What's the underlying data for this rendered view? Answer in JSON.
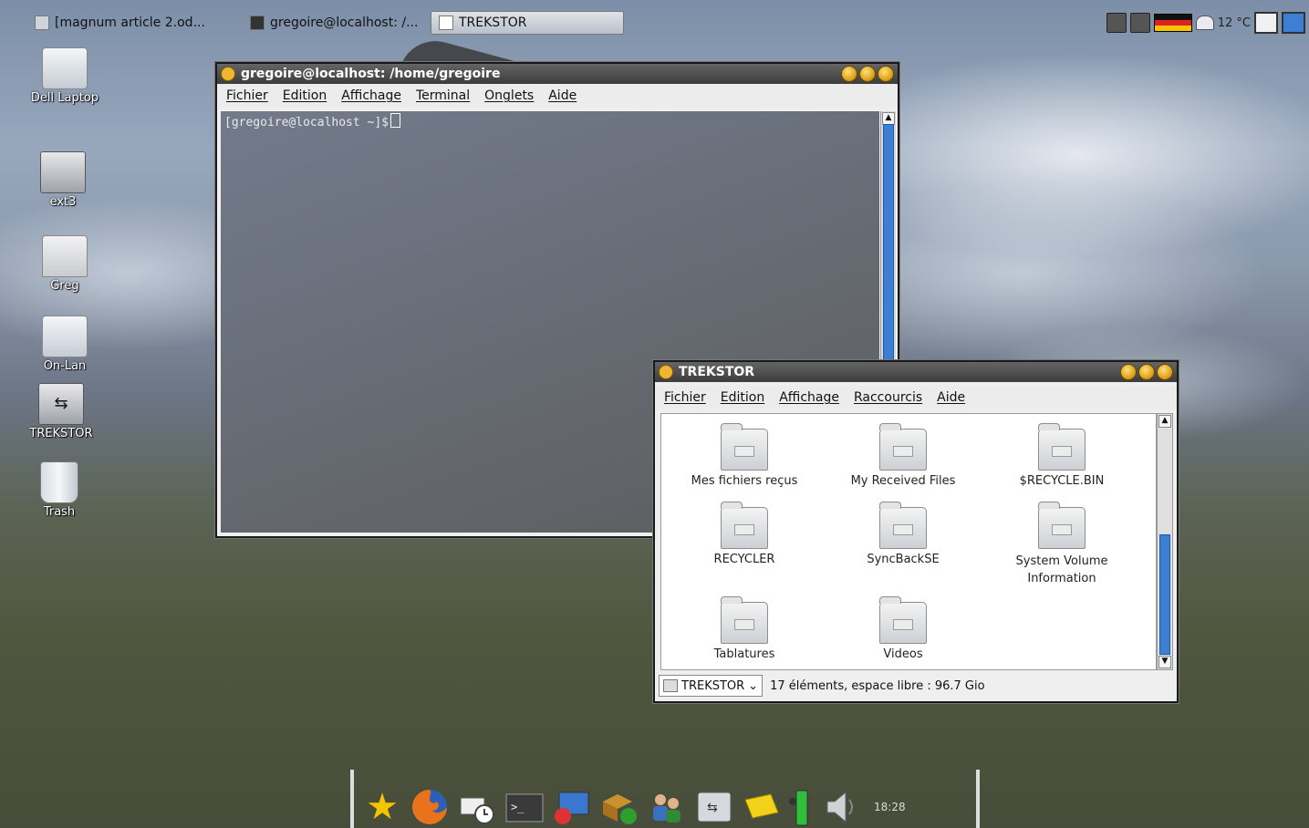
{
  "taskbar": {
    "tasks": [
      {
        "label": "[magnum article 2.od..."
      },
      {
        "label": "gregoire@localhost: /..."
      },
      {
        "label": "TREKSTOR"
      }
    ],
    "temperature": "12 °C"
  },
  "desktop": {
    "icons": [
      {
        "label": "Dell Laptop",
        "icon": "laptop-icon"
      },
      {
        "label": "ext3",
        "icon": "drive-icon"
      },
      {
        "label": "Greg",
        "icon": "home-folder-icon"
      },
      {
        "label": "On-Lan",
        "icon": "network-icon"
      },
      {
        "label": "TREKSTOR",
        "icon": "usb-drive-icon"
      },
      {
        "label": "Trash",
        "icon": "trash-icon"
      }
    ]
  },
  "terminal": {
    "title": "gregoire@localhost: /home/gregoire",
    "menu": [
      "Fichier",
      "Edition",
      "Affichage",
      "Terminal",
      "Onglets",
      "Aide"
    ],
    "prompt": "[gregoire@localhost ~]$"
  },
  "file_manager": {
    "title": "TREKSTOR",
    "menu": [
      "Fichier",
      "Edition",
      "Affichage",
      "Raccourcis",
      "Aide"
    ],
    "items": [
      {
        "label": "Mes fichiers reçus"
      },
      {
        "label": "My Received Files"
      },
      {
        "label": "$RECYCLE.BIN"
      },
      {
        "label": "RECYCLER"
      },
      {
        "label": "SyncBackSE"
      },
      {
        "label": "System Volume Information"
      },
      {
        "label": "Tablatures"
      },
      {
        "label": "Videos"
      }
    ],
    "location": "TREKSTOR",
    "status": "17 éléments, espace libre : 96.7 Gio"
  },
  "dock": {
    "items": [
      "star-icon",
      "firefox-icon",
      "mail-clock-icon",
      "terminal-icon",
      "display-settings-icon",
      "package-manager-icon",
      "users-icon",
      "usb-drive-icon",
      "notes-icon",
      "battery-icon",
      "volume-icon"
    ],
    "clock": "18:28"
  },
  "colors": {
    "accent": "#3e7fd6",
    "titlebar": "#3c3c3c",
    "window_button": "#e0a41c"
  }
}
